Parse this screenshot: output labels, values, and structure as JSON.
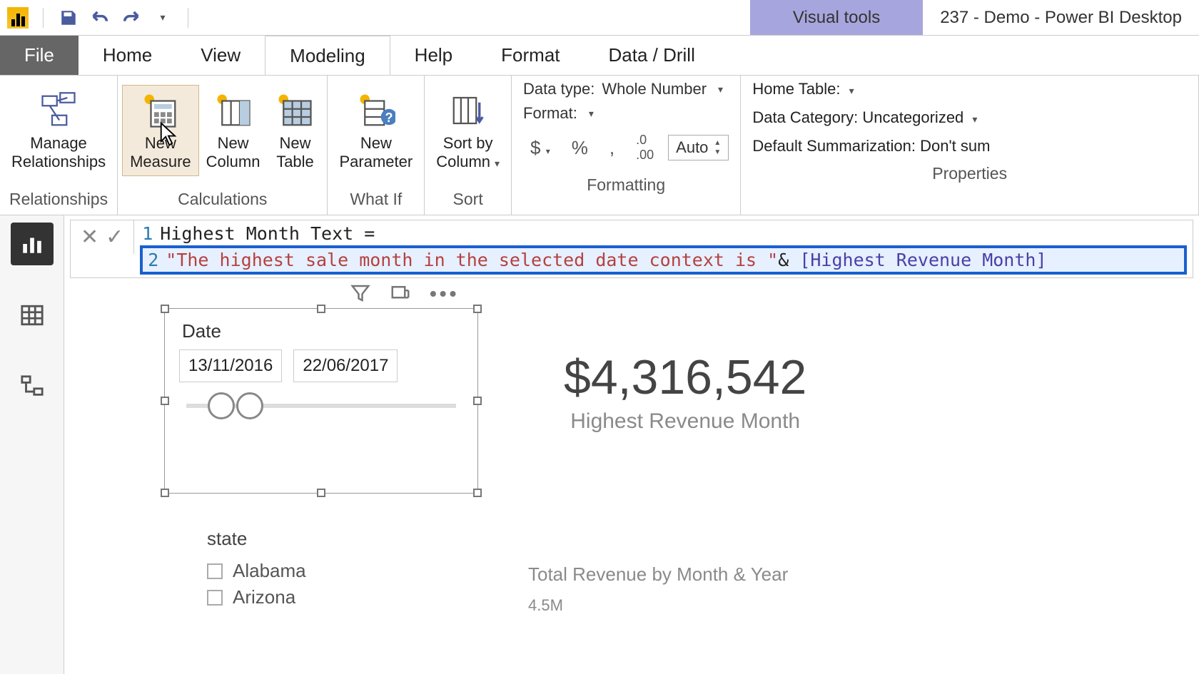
{
  "titlebar": {
    "visual_tools": "Visual tools",
    "window_title": "237 - Demo - Power BI Desktop"
  },
  "tabs": {
    "file": "File",
    "home": "Home",
    "view": "View",
    "modeling": "Modeling",
    "help": "Help",
    "format": "Format",
    "data_drill": "Data / Drill"
  },
  "ribbon": {
    "relationships": {
      "manage": "Manage\nRelationships",
      "group": "Relationships"
    },
    "calculations": {
      "new_measure": "New\nMeasure",
      "new_column": "New\nColumn",
      "new_table": "New\nTable",
      "group": "Calculations"
    },
    "whatif": {
      "new_parameter": "New\nParameter",
      "group": "What If"
    },
    "sort": {
      "sort_by_column": "Sort by\nColumn",
      "group": "Sort"
    },
    "formatting": {
      "data_type_label": "Data type:",
      "data_type_value": "Whole Number",
      "format_label": "Format:",
      "auto": "Auto",
      "group": "Formatting"
    },
    "properties": {
      "home_table_label": "Home Table:",
      "data_category_label": "Data Category:",
      "data_category_value": "Uncategorized",
      "default_summ_label": "Default Summarization:",
      "default_summ_value": "Don't sum",
      "group": "Properties"
    }
  },
  "formula": {
    "line1": "Highest Month Text =",
    "line2_str": "\"The highest sale month in the selected date context is \"",
    "line2_amp": "& ",
    "line2_meas": "[Highest Revenue Month]"
  },
  "slicer": {
    "title": "Date",
    "start": "13/11/2016",
    "end": "22/06/2017"
  },
  "card": {
    "value": "$4,316,542",
    "label": "Highest Revenue Month"
  },
  "state": {
    "title": "state",
    "items": [
      "Alabama",
      "Arizona"
    ]
  },
  "chart": {
    "title": "Total Revenue by Month & Year",
    "y_tick": "4.5M"
  }
}
